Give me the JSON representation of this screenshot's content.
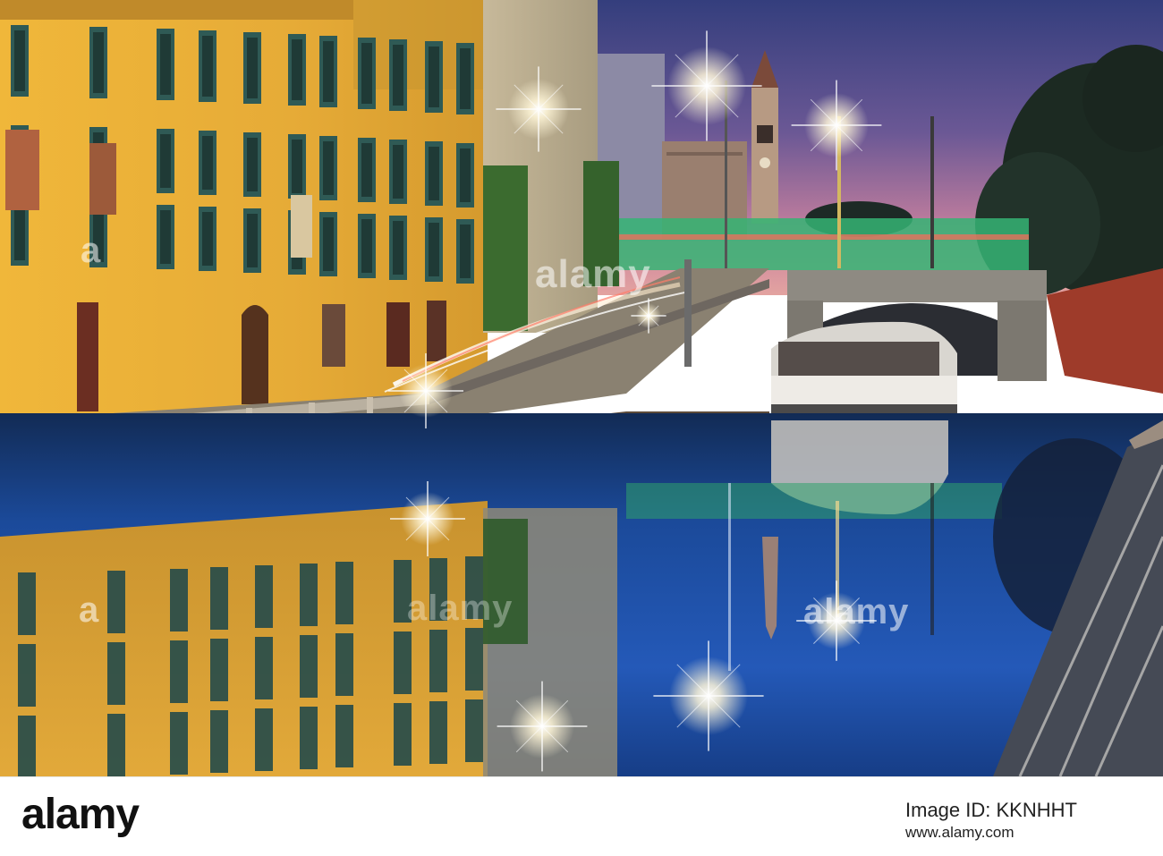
{
  "photo": {
    "subject": "Naviglio Grande canal at dusk with yellow buildings, boat, bridge and bell tower",
    "colors": {
      "sky_top": "#3d4a8a",
      "sky_mid": "#7a5f9a",
      "sky_low": "#d98fa4",
      "building_yellow": "#e7b23c",
      "water_blue": "#1f4fa8",
      "trail_green": "#36c27a"
    }
  },
  "watermark": {
    "text_large": "alamy",
    "text_small": "a",
    "brand_symbol": "alamy-watermark-logo"
  },
  "footer": {
    "logo_text": "alamy",
    "image_id": "Image ID: KKNHHT",
    "site_url": "www.alamy.com"
  }
}
